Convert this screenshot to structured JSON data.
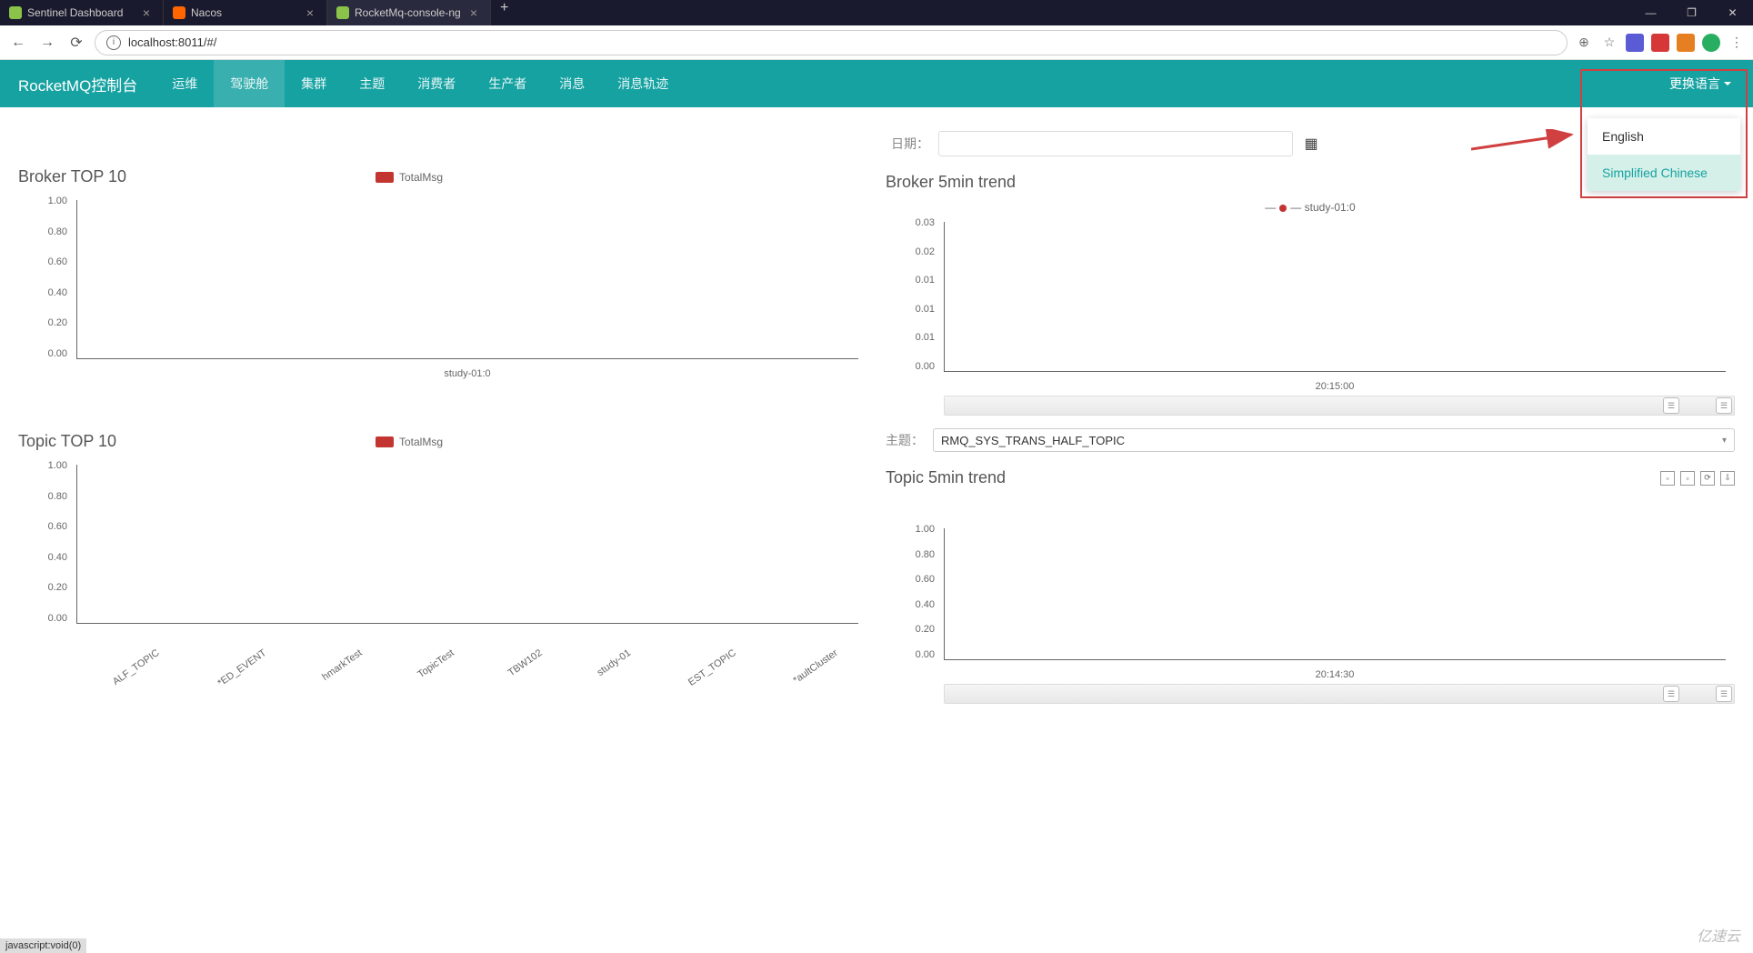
{
  "browser": {
    "tabs": [
      {
        "title": "Sentinel Dashboard",
        "icon_color": "#8bc34a"
      },
      {
        "title": "Nacos",
        "icon_color": "#ff6600"
      },
      {
        "title": "RocketMq-console-ng",
        "icon_color": "#8bc34a",
        "active": true
      }
    ],
    "url": "localhost:8011/#/",
    "win": {
      "min": "—",
      "max": "❐",
      "close": "✕"
    }
  },
  "navbar": {
    "brand": "RocketMQ控制台",
    "items": [
      "运维",
      "驾驶舱",
      "集群",
      "主题",
      "消费者",
      "生产者",
      "消息",
      "消息轨迹"
    ],
    "active_index": 1,
    "lang_label": "更换语言"
  },
  "lang_dropdown": {
    "options": [
      "English",
      "Simplified Chinese"
    ],
    "selected_index": 1
  },
  "filters": {
    "date_label": "日期：",
    "topic_label": "主题：",
    "topic_value": "RMQ_SYS_TRANS_HALF_TOPIC"
  },
  "charts": {
    "broker_top": {
      "title": "Broker TOP 10",
      "legend": "TotalMsg",
      "y_ticks": [
        "1.00",
        "0.80",
        "0.60",
        "0.40",
        "0.20",
        "0.00"
      ],
      "x_ticks": [
        "study-01:0"
      ]
    },
    "broker_trend": {
      "title": "Broker 5min trend",
      "legend_series": "study-01:0",
      "y_ticks": [
        "0.03",
        "0.02",
        "0.01",
        "0.01",
        "0.01",
        "0.00"
      ],
      "x_ticks": [
        "20:15:00"
      ]
    },
    "topic_top": {
      "title": "Topic TOP 10",
      "legend": "TotalMsg",
      "y_ticks": [
        "1.00",
        "0.80",
        "0.60",
        "0.40",
        "0.20",
        "0.00"
      ],
      "x_ticks": [
        "ALF_TOPIC",
        "*ED_EVENT",
        "hmarkTest",
        "TopicTest",
        "TBW102",
        "study-01",
        "EST_TOPIC",
        "*aultCluster"
      ]
    },
    "topic_trend": {
      "title": "Topic 5min trend",
      "y_ticks": [
        "1.00",
        "0.80",
        "0.60",
        "0.40",
        "0.20",
        "0.00"
      ],
      "x_ticks": [
        "20:14:30"
      ]
    }
  },
  "chart_data": [
    {
      "type": "bar",
      "title": "Broker TOP 10",
      "categories": [
        "study-01:0"
      ],
      "series": [
        {
          "name": "TotalMsg",
          "values": [
            0
          ]
        }
      ],
      "ylim": [
        0,
        1
      ]
    },
    {
      "type": "line",
      "title": "Broker 5min trend",
      "x": [
        "20:15:00"
      ],
      "series": [
        {
          "name": "study-01:0",
          "values": [
            0
          ]
        }
      ],
      "ylim": [
        0,
        0.03
      ]
    },
    {
      "type": "bar",
      "title": "Topic TOP 10",
      "categories": [
        "ALF_TOPIC",
        "*ED_EVENT",
        "hmarkTest",
        "TopicTest",
        "TBW102",
        "study-01",
        "EST_TOPIC",
        "*aultCluster"
      ],
      "series": [
        {
          "name": "TotalMsg",
          "values": [
            0,
            0,
            0,
            0,
            0,
            0,
            0,
            0
          ]
        }
      ],
      "ylim": [
        0,
        1
      ]
    },
    {
      "type": "line",
      "title": "Topic 5min trend",
      "x": [
        "20:14:30"
      ],
      "series": [
        {
          "name": "",
          "values": [
            0
          ]
        }
      ],
      "ylim": [
        0,
        1
      ]
    }
  ],
  "status": "javascript:void(0)",
  "watermark": "亿速云"
}
